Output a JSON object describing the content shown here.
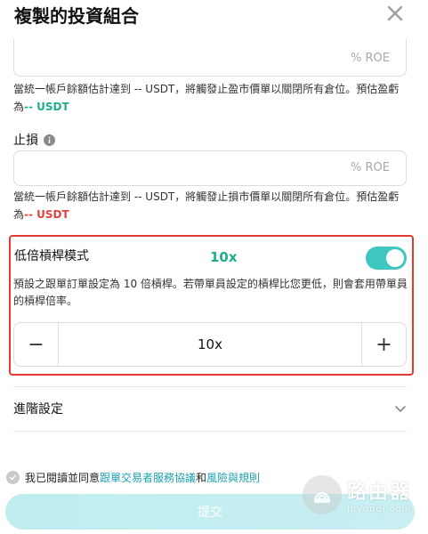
{
  "header": {
    "title": "複製的投資組合"
  },
  "take_profit": {
    "unit": "% ROE",
    "hint_prefix": "當統一帳戶餘額估計達到 -- USDT，將觸發止盈市價單以關閉所有倉位。預估盈虧為",
    "hint_value": "-- USDT"
  },
  "stop_loss": {
    "label": "止損",
    "unit": "% ROE",
    "hint_prefix": "當統一帳戶餘額估計達到 -- USDT，將觸發止損市價單以關閉所有倉位。預估盈虧為",
    "hint_value": "-- USDT"
  },
  "low_leverage": {
    "label": "低倍槓桿模式",
    "annotation": "10x",
    "enabled": true,
    "description": "預設之跟單訂單設定為 10 倍槓桿。若帶單員設定的槓桿比您更低，則會套用帶單員的槓桿倍率。",
    "stepper_value": "10x",
    "minus_label": "−",
    "plus_label": "+"
  },
  "advanced": {
    "label": "進階設定"
  },
  "agreement": {
    "prefix": "我已閱讀並同意",
    "link1": "跟單交易者服務協議",
    "and": "和",
    "link2": "風險與規則"
  },
  "submit": {
    "label": "提交"
  },
  "watermark": {
    "main": "路由器",
    "sub": "luyouqi.com"
  },
  "colors": {
    "accent": "#3ec6c0",
    "gain": "#1fae8b",
    "loss": "#e0413c",
    "highlight": "#e33b33",
    "link": "#1a9fb0"
  }
}
